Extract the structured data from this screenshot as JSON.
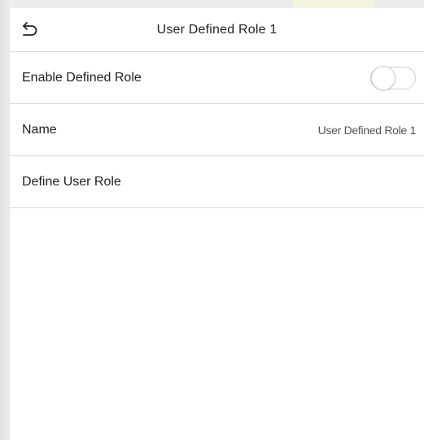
{
  "header": {
    "title": "User Defined Role 1",
    "back_icon": "back-arrow-icon"
  },
  "settings": {
    "enable_role": {
      "label": "Enable Defined Role",
      "enabled": false
    },
    "name": {
      "label": "Name",
      "value": "User Defined Role 1"
    },
    "define_role": {
      "label": "Define User Role"
    }
  },
  "colors": {
    "background": "#ffffff",
    "divider": "#dcdcdc",
    "text": "#1e1e1e",
    "secondary_text": "#555555",
    "toggle_border": "#cfcfcf"
  }
}
